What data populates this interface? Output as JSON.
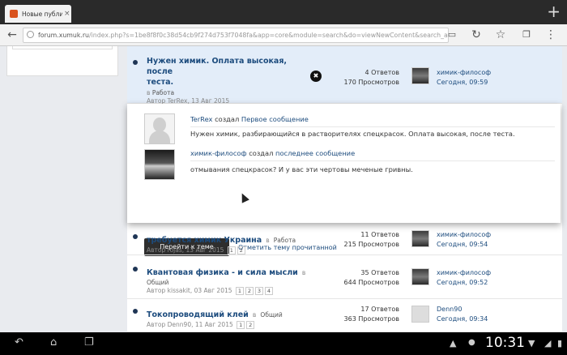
{
  "browser": {
    "tab_title": "Новые публика",
    "tab_close": "×",
    "new_tab": "+",
    "url_host": "forum.xumuk.ru",
    "url_path": "/index.php?s=1be8f8f0c38d54cb9f274d753f7048fa&app=core&module=search&do=viewNewContent&search_ap"
  },
  "topics": [
    {
      "title": "Нужен химик. Оплата высокая, после теста.",
      "title_line1": "Нужен химик. Оплата высокая, после",
      "title_line2": "теста.",
      "in_prefix": "в",
      "forum": "Работа",
      "author_line": "Автор TerRex, 13 Авг 2015",
      "answers": "4 Ответов",
      "views": "170 Просмотров",
      "last_user": "химик-философ",
      "last_date": "Сегодня, 09:59"
    },
    {
      "title": "требуется химик Украина",
      "in_prefix": "в",
      "forum": "Работа",
      "author_line": "Автор rojas, 13 Авг 2015",
      "pages": [
        "1",
        "2"
      ],
      "answers": "11 Ответов",
      "views": "215 Просмотров",
      "last_user": "химик-философ",
      "last_date": "Сегодня, 09:54"
    },
    {
      "title": "Квантовая физика - и сила мысли",
      "in_prefix": "в",
      "forum": "Общий",
      "author_line": "Автор kissakit, 03 Авг 2015",
      "pages": [
        "1",
        "2",
        "3",
        "4"
      ],
      "answers": "35 Ответов",
      "views": "644 Просмотров",
      "last_user": "химик-философ",
      "last_date": "Сегодня, 09:52"
    },
    {
      "title": "Токопроводящий клей",
      "in_prefix": "в",
      "forum": "Общий",
      "author_line": "Автор Denn90, 11 Авг 2015",
      "pages": [
        "1",
        "2"
      ],
      "answers": "17 Ответов",
      "views": "363 Просмотров",
      "last_user": "Denn90",
      "last_date": "Сегодня, 09:34"
    }
  ],
  "preview": {
    "first_user": "TerRex",
    "created_word": "создал",
    "first_link": "Первое сообщение",
    "first_text": "Нужен химик, разбирающийся в растворителях спецкрасок. Оплата высокая, после теста.",
    "last_user": "химик-философ",
    "last_link": "последнее сообщение",
    "last_text": "отмывания спецкрасок? И у вас эти чертовы меченые гривны.",
    "go_button": "Перейти к теме",
    "mark_read": "Отметить тему прочитанной",
    "close": "✖"
  },
  "system": {
    "clock": "10:31"
  }
}
